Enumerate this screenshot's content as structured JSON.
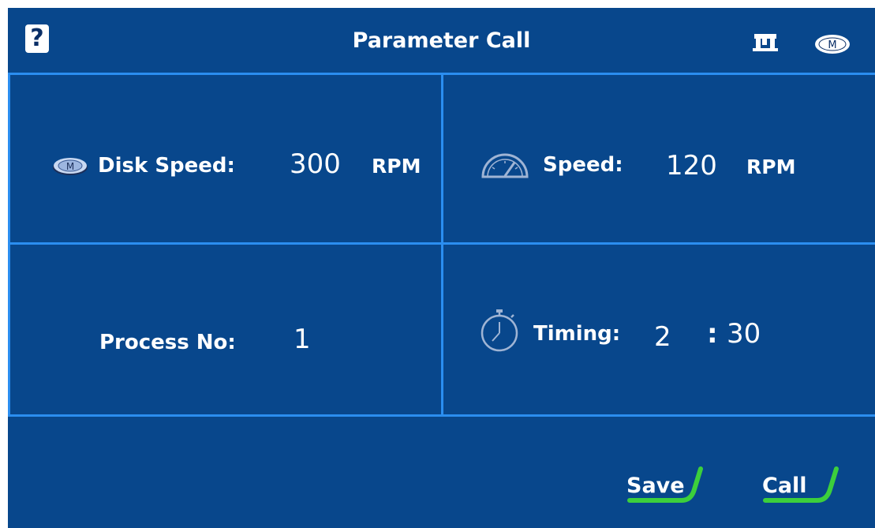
{
  "header": {
    "title": "Parameter Call",
    "help_label": "?",
    "icons": [
      "machine-icon",
      "motor-icon"
    ],
    "motor_badge": "M"
  },
  "panels": {
    "disk_speed": {
      "icon": "motor-icon",
      "icon_badge": "M",
      "label": "Disk Speed:",
      "value": "300",
      "unit": "RPM"
    },
    "speed": {
      "icon": "speedometer-icon",
      "label": "Speed:",
      "value": "120",
      "unit": "RPM"
    },
    "process": {
      "label": "Process No:",
      "value": "1"
    },
    "timing": {
      "icon": "stopwatch-icon",
      "label": "Timing:",
      "minutes": "2",
      "separator": ":",
      "seconds": "30"
    }
  },
  "actions": {
    "save_label": "Save",
    "call_label": "Call"
  },
  "colors": {
    "background": "#08478c",
    "divider": "#2b8ef0",
    "button_accent": "#3ccf3c",
    "text": "#ffffff"
  }
}
